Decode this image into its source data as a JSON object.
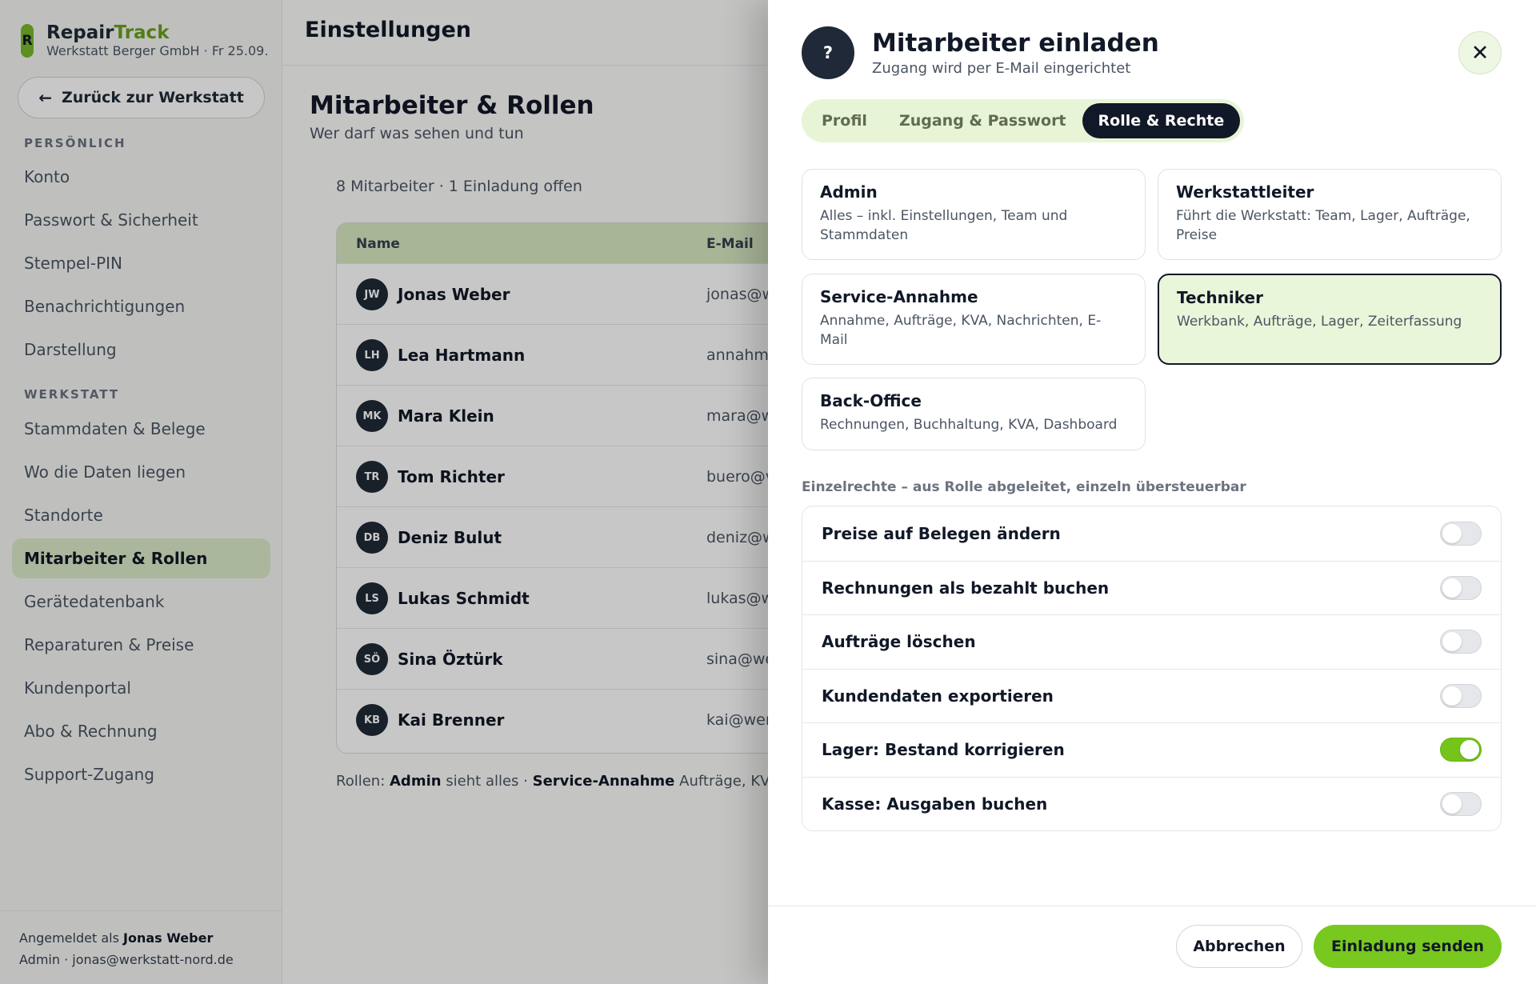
{
  "brand": {
    "name_part1": "Repair",
    "name_part2": "Track",
    "mark": "R",
    "subtitle": "Werkstatt Berger GmbH · Fr 25.09."
  },
  "sidebar": {
    "back_label": "Zurück zur Werkstatt",
    "back_icon": "arrow-left-icon",
    "section_personal": "PERSÖNLICH",
    "personal_items": [
      "Konto",
      "Passwort & Sicherheit",
      "Stempel-PIN",
      "Benachrichtigungen",
      "Darstellung"
    ],
    "section_workshop": "WERKSTATT",
    "workshop_items": [
      "Stammdaten & Belege",
      "Wo die Daten liegen",
      "Standorte",
      "Mitarbeiter & Rollen",
      "Gerätedatenbank",
      "Reparaturen & Preise",
      "Kundenportal",
      "Abo & Rechnung",
      "Support-Zugang"
    ],
    "active_item": "Mitarbeiter & Rollen",
    "footer": {
      "prefix": "Angemeldet als",
      "user": "Jonas Weber",
      "detail": "Admin · jonas@werkstatt-nord.de"
    }
  },
  "main": {
    "topbar_title": "Einstellungen",
    "page_title": "Mitarbeiter & Rollen",
    "page_subtitle": "Wer darf was sehen und tun",
    "count_line": "8 Mitarbeiter · 1 Einladung offen",
    "table": {
      "columns": [
        "Name",
        "E-Mail"
      ],
      "rows": [
        {
          "initials": "JW",
          "name": "Jonas Weber",
          "email": "jonas@w"
        },
        {
          "initials": "LH",
          "name": "Lea Hartmann",
          "email": "annahm"
        },
        {
          "initials": "MK",
          "name": "Mara Klein",
          "email": "mara@w"
        },
        {
          "initials": "TR",
          "name": "Tom Richter",
          "email": "buero@v"
        },
        {
          "initials": "DB",
          "name": "Deniz Bulut",
          "email": "deniz@w"
        },
        {
          "initials": "LS",
          "name": "Lukas Schmidt",
          "email": "lukas@w"
        },
        {
          "initials": "SÖ",
          "name": "Sina Öztürk",
          "email": "sina@we"
        },
        {
          "initials": "KB",
          "name": "Kai Brenner",
          "email": "kai@wer"
        }
      ]
    },
    "roles_line": {
      "prefix": "Rollen:",
      "role1": "Admin",
      "text1": "sieht alles ·",
      "role2": "Service-Annahme",
      "text2": "Aufträge, KVA,"
    }
  },
  "drawer": {
    "icon": "?",
    "title": "Mitarbeiter einladen",
    "subtitle": "Zugang wird per E-Mail eingerichtet",
    "close_icon": "close-icon",
    "tabs": [
      "Profil",
      "Zugang & Passwort",
      "Rolle & Rechte"
    ],
    "active_tab": "Rolle & Rechte",
    "roles": [
      {
        "title": "Admin",
        "desc": "Alles – inkl. Einstellungen, Team und Stammdaten",
        "selected": false
      },
      {
        "title": "Werkstattleiter",
        "desc": "Führt die Werkstatt: Team, Lager, Aufträge, Preise",
        "selected": false
      },
      {
        "title": "Service-Annahme",
        "desc": "Annahme, Aufträge, KVA, Nachrichten, E-Mail",
        "selected": false
      },
      {
        "title": "Techniker",
        "desc": "Werkbank, Aufträge, Lager, Zeiterfassung",
        "selected": true
      },
      {
        "title": "Back-Office",
        "desc": "Rechnungen, Buchhaltung, KVA, Dashboard",
        "selected": false
      }
    ],
    "permissions_heading": "Einzelrechte – aus Rolle abgeleitet, einzeln übersteuerbar",
    "permissions": [
      {
        "label": "Preise auf Belegen ändern",
        "enabled": false
      },
      {
        "label": "Rechnungen als bezahlt buchen",
        "enabled": false
      },
      {
        "label": "Aufträge löschen",
        "enabled": false
      },
      {
        "label": "Kundendaten exportieren",
        "enabled": false
      },
      {
        "label": "Lager: Bestand korrigieren",
        "enabled": true
      },
      {
        "label": "Kasse: Ausgaben buchen",
        "enabled": false
      }
    ],
    "cancel_label": "Abbrechen",
    "submit_label": "Einladung senden"
  },
  "colors": {
    "accent": "#78c81f",
    "accent_soft": "#eaf6d9",
    "dark": "#111827"
  }
}
